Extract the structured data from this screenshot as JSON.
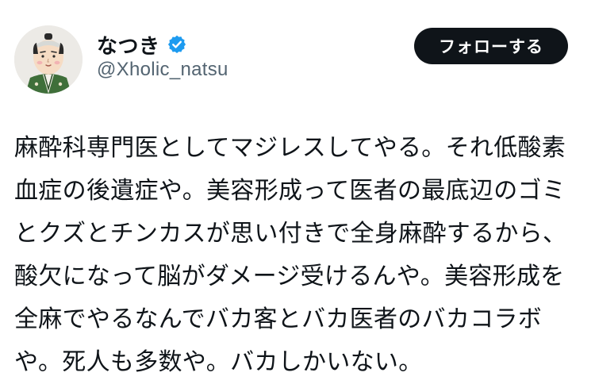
{
  "user": {
    "display_name": "なつき",
    "handle": "@Xholic_natsu",
    "verified_icon": "verified-badge-icon",
    "verified_color": "#1d9bf0"
  },
  "actions": {
    "follow_label": "フォローする"
  },
  "tweet": {
    "lines": [
      "麻酔科専門医としてマジレスしてやる。それ低酸素",
      "血症の後遺症や。美容形成って医者の最底辺のゴミ",
      "とクズとチンカスが思い付きで全身麻酔するから、",
      "酸欠になって脳がダメージ受けるんや。美容形成を",
      "全麻でやるなんでバカ客とバカ医者のバカコラボ",
      "や。死人も多数や。バカしかいない。"
    ]
  }
}
